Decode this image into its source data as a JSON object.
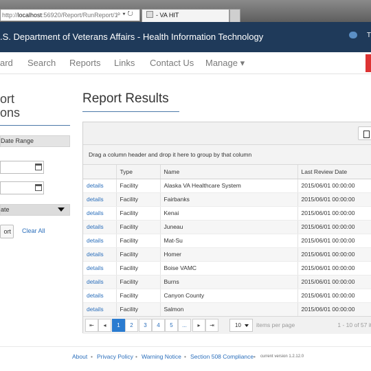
{
  "browser": {
    "url_prefix": "http://",
    "url_host": "localhost",
    "url_rest": ":56920/Report/RunReport/1",
    "addr_icons": "⌕ ▾ ↻",
    "tab_title": "- VA HIT"
  },
  "header": {
    "title": ".S. Department of Veterans Affairs - Health Information Technology",
    "right_letter": "T"
  },
  "nav": {
    "items": [
      "ard",
      "Search",
      "Reports",
      "Links",
      "Contact Us",
      "Manage ▾"
    ]
  },
  "sidebar": {
    "title_line1": "ort",
    "title_line2": "ons",
    "date_range_label": "Date Range",
    "date_filter_label": "ate",
    "report_button": "ort",
    "clear_all": "Clear All"
  },
  "main": {
    "title": "Report Results",
    "group_hint": "Drag a column header and drop it here to group by that column",
    "columns": [
      "",
      "Type",
      "Name",
      "Last Review Date"
    ],
    "rows": [
      [
        "details",
        "Facility",
        "Alaska VA Healthcare System",
        "2015/06/01 00:00:00"
      ],
      [
        "details",
        "Facility",
        "Fairbanks",
        "2015/06/01 00:00:00"
      ],
      [
        "details",
        "Facility",
        "Kenai",
        "2015/06/01 00:00:00"
      ],
      [
        "details",
        "Facility",
        "Juneau",
        "2015/06/01 00:00:00"
      ],
      [
        "details",
        "Facility",
        "Mat-Su",
        "2015/06/01 00:00:00"
      ],
      [
        "details",
        "Facility",
        "Homer",
        "2015/06/01 00:00:00"
      ],
      [
        "details",
        "Facility",
        "Boise VAMC",
        "2015/06/01 00:00:00"
      ],
      [
        "details",
        "Facility",
        "Burns",
        "2015/06/01 00:00:00"
      ],
      [
        "details",
        "Facility",
        "Canyon County",
        "2015/06/01 00:00:00"
      ],
      [
        "details",
        "Facility",
        "Salmon",
        "2015/06/01 00:00:00"
      ]
    ]
  },
  "pager": {
    "first": "⇤",
    "prev": "◂",
    "pages": [
      "1",
      "2",
      "3",
      "4",
      "5",
      "..."
    ],
    "next": "▸",
    "last": "⇥",
    "page_size": "10",
    "page_size_label": "items per page",
    "info": "1 - 10 of 57 it"
  },
  "footer": {
    "links": [
      "About",
      "Privacy Policy",
      "Warning Notice",
      "Section 508 Compliance"
    ],
    "separator": "•",
    "version": "current version 1.2.12.0"
  }
}
